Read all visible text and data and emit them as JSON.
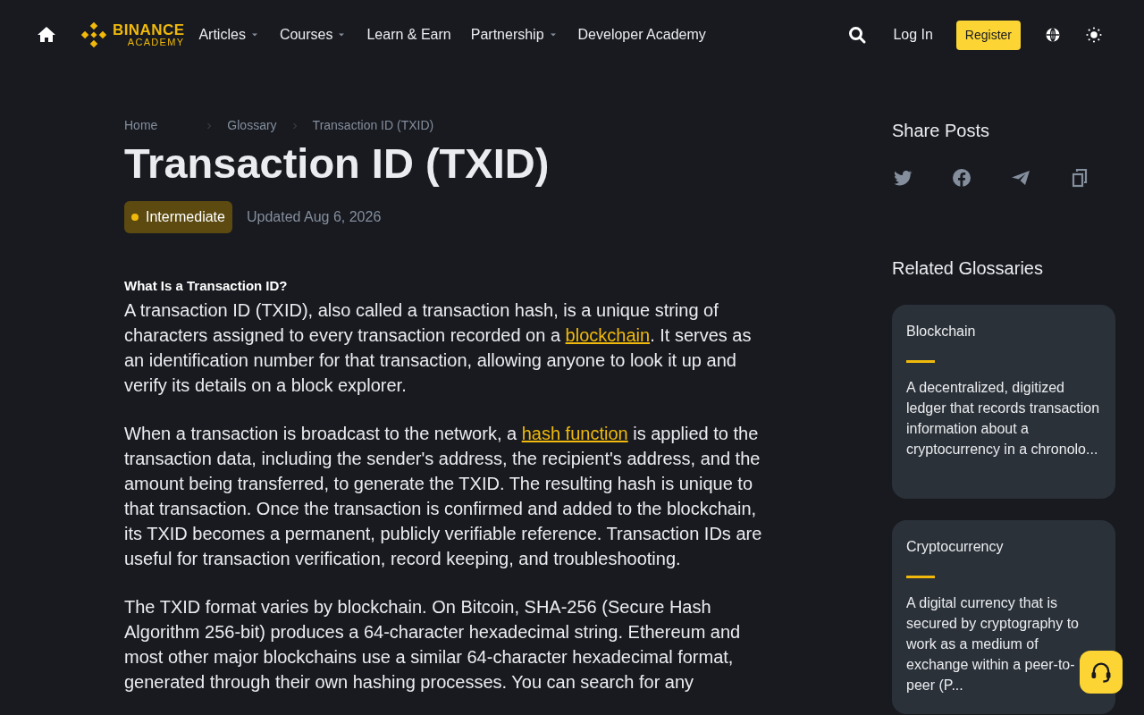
{
  "nav": {
    "logo": {
      "top": "BINANCE",
      "bottom": "ACADEMY"
    },
    "items": [
      {
        "label": "Articles",
        "dropdown": true
      },
      {
        "label": "Courses",
        "dropdown": true
      },
      {
        "label": "Learn & Earn",
        "dropdown": false
      },
      {
        "label": "Partnership",
        "dropdown": true
      },
      {
        "label": "Developer Academy",
        "dropdown": false
      }
    ],
    "login": "Log In",
    "register": "Register"
  },
  "breadcrumb": [
    "Home",
    "Glossary",
    "Transaction ID (TXID)"
  ],
  "title": "Transaction ID (TXID)",
  "level": {
    "label": "Intermediate",
    "color": "#f0b90b"
  },
  "updated": "Updated Aug 6, 2026",
  "section_heading": "What Is a Transaction ID?",
  "paragraphs": [
    [
      {
        "kind": "text",
        "text": "A transaction ID (TXID), also called a transaction hash, is a unique string of characters assigned to every transaction recorded on a "
      },
      {
        "kind": "link",
        "text": "blockchain"
      },
      {
        "kind": "text",
        "text": ". It serves as an identification number for that transaction, allowing anyone to look it up and verify its details on a block explorer."
      }
    ],
    [
      {
        "kind": "text",
        "text": "When a transaction is broadcast to the network, a "
      },
      {
        "kind": "link",
        "text": "hash function"
      },
      {
        "kind": "text",
        "text": " is applied to the transaction data, including the sender's address, the recipient's address, and the amount being transferred, to generate the TXID. The resulting hash is unique to that transaction. Once the transaction is confirmed and added to the blockchain, its TXID becomes a permanent, publicly verifiable reference. Transaction IDs are useful for transaction verification, record keeping, and troubleshooting."
      }
    ],
    [
      {
        "kind": "text",
        "text": "The TXID format varies by blockchain. On Bitcoin, SHA-256 (Secure Hash Algorithm 256-bit) produces a 64-character hexadecimal string. Ethereum and most other major blockchains use a similar 64-character hexadecimal format, generated through their own hashing processes. You can search for any"
      }
    ]
  ],
  "share": {
    "heading": "Share Posts",
    "icons": [
      {
        "kind": "twitter"
      },
      {
        "kind": "facebook"
      },
      {
        "kind": "telegram"
      },
      {
        "kind": "copy"
      }
    ]
  },
  "related": {
    "heading": "Related Glossaries",
    "cards": [
      {
        "title": "Blockchain",
        "text": "A decentralized, digitized ledger that records transaction information about a cryptocurrency in a chronolo..."
      },
      {
        "title": "Cryptocurrency",
        "text": "A digital currency that is secured by cryptography to work as a medium of exchange within a peer-to-peer (P..."
      }
    ]
  }
}
